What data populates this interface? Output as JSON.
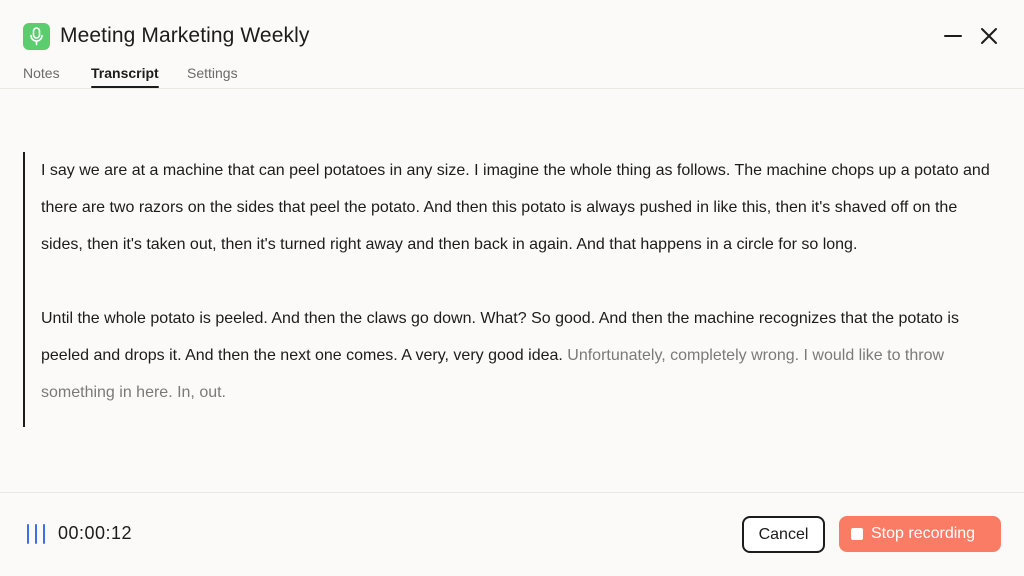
{
  "window": {
    "title": "Meeting Marketing Weekly",
    "app_icon": "microphone-icon",
    "controls": [
      "minimize-icon",
      "close-icon"
    ]
  },
  "tabs": [
    {
      "label": "Notes",
      "active": false
    },
    {
      "label": "Transcript",
      "active": true
    },
    {
      "label": "Settings",
      "active": false
    }
  ],
  "transcript": {
    "paragraphs": [
      {
        "text": "I say we are at a machine that can peel potatoes in any size. I imagine the whole thing as follows. The machine chops up a potato and there are two razors on the sides that peel the potato. And then this potato is always pushed in like this, then it's shaved off on the sides, then it's taken out, then it's turned right away and then back in again. And that happens in a circle for so long."
      },
      {
        "text": "Until the whole potato is peeled. And then the claws go down. What? So good. And then the machine recognizes that the potato is peeled and drops it. And then the next one comes. A very, very good idea.",
        "pending_text": "Unfortunately, completely wrong. I would like to throw something in here. In, out."
      }
    ]
  },
  "footer": {
    "timer": "00:00:12",
    "cancel_label": "Cancel",
    "stop_label": "Stop recording"
  },
  "colors": {
    "accent_green": "#5ccd6e",
    "stop_button": "#fb7c64",
    "waveform": "#3a6df0",
    "pending_text": "#7a7a7a"
  }
}
